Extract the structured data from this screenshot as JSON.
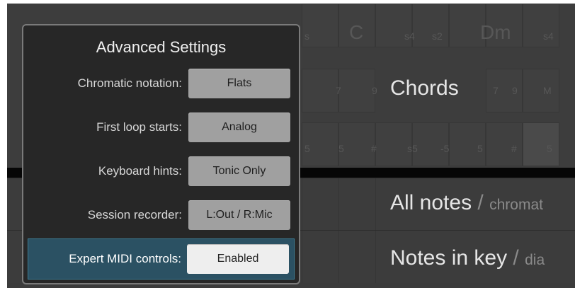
{
  "popup": {
    "title": "Advanced Settings",
    "settings": [
      {
        "label": "Chromatic notation:",
        "value": "Flats"
      },
      {
        "label": "First loop starts:",
        "value": "Analog"
      },
      {
        "label": "Keyboard hints:",
        "value": "Tonic Only"
      },
      {
        "label": "Session recorder:",
        "value": "L:Out / R:Mic"
      },
      {
        "label": "Expert MIDI controls:",
        "value": "Enabled",
        "highlighted": true
      }
    ]
  },
  "background": {
    "chords_label": "Chords",
    "faint_glyphs": [
      "C",
      "Dm",
      "s4",
      "s2",
      "s4",
      "s",
      "7",
      "9",
      "7",
      "9",
      "M",
      "5",
      "5",
      "#",
      "s5",
      "-5",
      "5",
      "#",
      "5"
    ],
    "rows": [
      {
        "main": "All notes",
        "separator": "/",
        "sub": "chromat"
      },
      {
        "main": "Notes in key",
        "separator": "/",
        "sub": "dia"
      }
    ]
  },
  "colors": {
    "popup_bg": "#272727",
    "highlight_row": "#2b5163",
    "button_bg": "#a0a0a0",
    "button_active_bg": "#eeeeee",
    "background_dark": "#3b3b3b"
  }
}
